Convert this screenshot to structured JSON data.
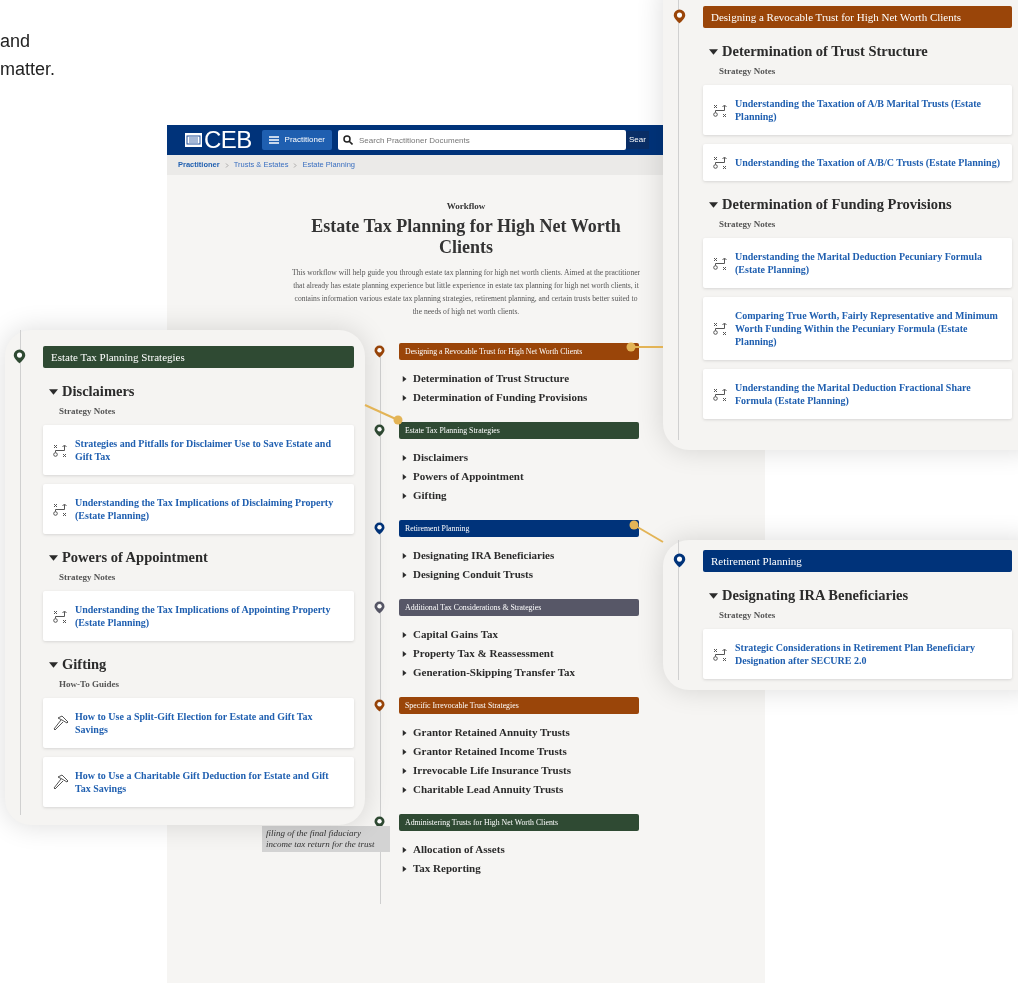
{
  "background_text": [
    "and",
    "matter."
  ],
  "app": {
    "header": {
      "logo": "CEB",
      "menu_button": "Practitioner",
      "search": {
        "placeholder": "Search Practitioner Documents"
      },
      "search_button": "Sear"
    },
    "breadcrumbs": [
      "Practitioner",
      "Trusts & Estates",
      "Estate Planning"
    ],
    "workflow": {
      "eyebrow": "Workflow",
      "title": "Estate Tax Planning for High Net Worth Clients",
      "description": "This workflow will help guide you through estate tax planning for high net worth clients. Aimed at the practitioner that already has estate planning experience but little experience in estate tax planning for high net worth clients, it contains information various estate tax planning strategies, retirement planning, and certain trusts better suited to the needs of high net worth clients."
    },
    "stages": [
      {
        "title": "Designing a Revocable Trust for High Net Worth Clients",
        "color": "#9a4509",
        "items": [
          {
            "label": "Determination of Trust Structure",
            "expanded": false
          },
          {
            "label": "Determination of Funding Provisions",
            "expanded": false
          }
        ]
      },
      {
        "title": "Estate Tax Planning Strategies",
        "color": "#2f4a33",
        "items": [
          {
            "label": "Disclaimers",
            "expanded": false
          },
          {
            "label": "Powers of Appointment",
            "expanded": false
          },
          {
            "label": "Gifting",
            "expanded": false
          }
        ]
      },
      {
        "title": "Retirement Planning",
        "color": "#00337a",
        "items": [
          {
            "label": "Designating IRA Beneficiaries",
            "expanded": false
          },
          {
            "label": "Designing Conduit Trusts",
            "expanded": false
          }
        ]
      },
      {
        "title": "Additional Tax Considerations & Strategies",
        "color": "#575767",
        "items": [
          {
            "label": "Capital Gains Tax",
            "expanded": false
          },
          {
            "label": "Property Tax & Reassessment",
            "expanded": false
          },
          {
            "label": "Generation-Skipping Transfer Tax",
            "expanded": false
          }
        ]
      },
      {
        "title": "Specific Irrevocable Trust Strategies",
        "color": "#9a4509",
        "items": [
          {
            "label": "Grantor Retained Annuity Trusts",
            "expanded": false
          },
          {
            "label": "Grantor Retained Income Trusts",
            "expanded": false
          },
          {
            "label": "Irrevocable Life Insurance Trusts",
            "expanded": false
          },
          {
            "label": "Charitable Lead Annuity Trusts",
            "expanded": false
          }
        ]
      },
      {
        "title": "Administering Trusts for High Net Worth Clients",
        "color": "#2f4a33",
        "items": [
          {
            "label": "Allocation of Assets",
            "expanded": false
          },
          {
            "label": "Tax Reporting",
            "expanded": false
          }
        ]
      }
    ],
    "tooltip": {
      "lines": [
        "filing of the final fiduciary",
        "income tax return for the trust"
      ]
    }
  },
  "callouts": [
    {
      "title": "Estate Tax Planning Strategies",
      "color": "#2f4a33",
      "sections": [
        {
          "heading": "Disclaimers",
          "expanded": true,
          "category": "Strategy Notes",
          "links": [
            {
              "kind": "strategy",
              "text": "Strategies and Pitfalls for Disclaimer Use to Save Estate and Gift Tax"
            },
            {
              "kind": "strategy",
              "text": "Understanding the Tax Implications of Disclaiming Property (Estate Planning)"
            }
          ]
        },
        {
          "heading": "Powers of Appointment",
          "expanded": true,
          "category": "Strategy Notes",
          "links": [
            {
              "kind": "strategy",
              "text": "Understanding the Tax Implications of Appointing Property (Estate Planning)"
            }
          ]
        },
        {
          "heading": "Gifting",
          "expanded": true,
          "category": "How-To Guides",
          "links": [
            {
              "kind": "howto",
              "text": "How to Use a Split-Gift Election for Estate and Gift Tax Savings"
            },
            {
              "kind": "howto",
              "text": "How to Use a Charitable Gift Deduction for Estate and Gift Tax Savings"
            }
          ]
        }
      ]
    },
    {
      "title": "Designing a Revocable Trust for High Net Worth Clients",
      "color": "#9a4509",
      "sections": [
        {
          "heading": "Determination of Trust Structure",
          "expanded": true,
          "category": "Strategy Notes",
          "links": [
            {
              "kind": "strategy",
              "text": "Understanding the Taxation of A/B Marital Trusts (Estate Planning)"
            },
            {
              "kind": "strategy",
              "text": "Understanding the Taxation of A/B/C Trusts (Estate Planning)"
            }
          ]
        },
        {
          "heading": "Determination of Funding Provisions",
          "expanded": true,
          "category": "Strategy Notes",
          "links": [
            {
              "kind": "strategy",
              "text": "Understanding the Marital Deduction Pecuniary Formula (Estate Planning)"
            },
            {
              "kind": "strategy",
              "text": "Comparing True Worth, Fairly Representative and Minimum Worth Funding Within the Pecuniary Formula (Estate Planning)"
            },
            {
              "kind": "strategy",
              "text": "Understanding the Marital Deduction Fractional Share Formula (Estate Planning)"
            }
          ]
        }
      ]
    },
    {
      "title": "Retirement Planning",
      "color": "#00337a",
      "sections": [
        {
          "heading": "Designating IRA Beneficiaries",
          "expanded": true,
          "category": "Strategy Notes",
          "links": [
            {
              "kind": "strategy",
              "text": "Strategic Considerations in Retirement Plan Beneficiary Designation after SECURE 2.0"
            }
          ]
        }
      ]
    }
  ]
}
